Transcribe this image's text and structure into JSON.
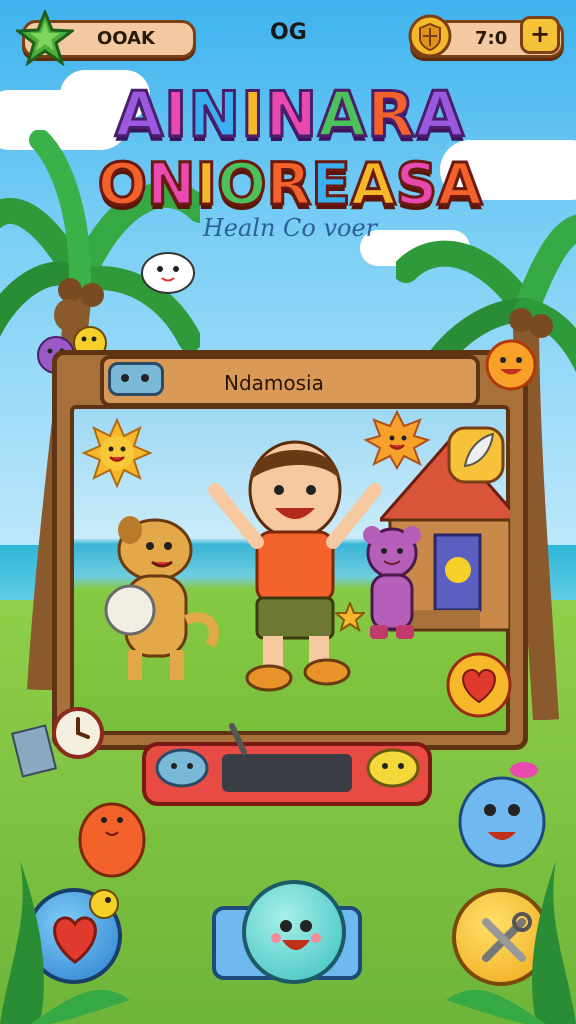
{
  "top_bar": {
    "left_badge_label": "OOAK",
    "center_label": "OG",
    "right_counter_label": "7:0",
    "plus_label": "+"
  },
  "title": {
    "line1": "AININARA",
    "line2": "ONIOREASA",
    "subtitle": "Healn Co voer"
  },
  "frame": {
    "header_label": "Ndamosia"
  },
  "icons": {
    "star": "star-icon",
    "shield": "shield-icon",
    "plus": "plus-icon",
    "heart": "heart-icon",
    "tools": "tools-icon"
  },
  "colors": {
    "frame_wood": "#a8703a",
    "pill_bg": "#f2c9a0",
    "gold": "#f5b82a",
    "heart_red": "#e03a2e"
  }
}
